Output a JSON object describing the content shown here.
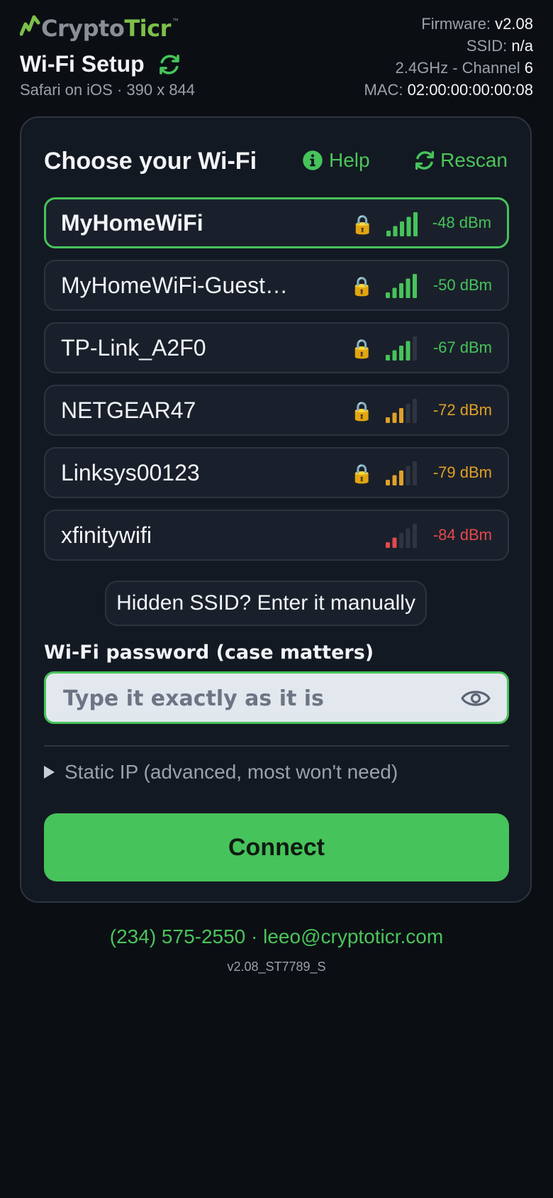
{
  "brand": {
    "logo_prefix": "Crypto",
    "logo_suffix": "Ticr",
    "trademark": "™"
  },
  "header": {
    "title": "Wi-Fi Setup",
    "subtitle": "Safari on iOS · 390 x 844",
    "firmware_label": "Firmware:",
    "firmware_value": "v2.08",
    "ssid_label": "SSID:",
    "ssid_value": "n/a",
    "band_label": "2.4GHz - Channel",
    "band_value": "6",
    "mac_label": "MAC:",
    "mac_value": "02:00:00:00:00:08"
  },
  "card": {
    "title": "Choose your Wi-Fi",
    "help_label": "Help",
    "rescan_label": "Rescan"
  },
  "networks": [
    {
      "name": "MyHomeWiFi",
      "locked": true,
      "signal_bars": 5,
      "dbm": "-48 dBm",
      "level": "good",
      "selected": true
    },
    {
      "name": "MyHomeWiFi-Guest…",
      "locked": true,
      "signal_bars": 5,
      "dbm": "-50 dBm",
      "level": "good",
      "selected": false
    },
    {
      "name": "TP-Link_A2F0",
      "locked": true,
      "signal_bars": 4,
      "dbm": "-67 dBm",
      "level": "good",
      "selected": false
    },
    {
      "name": "NETGEAR47",
      "locked": true,
      "signal_bars": 3,
      "dbm": "-72 dBm",
      "level": "fair",
      "selected": false
    },
    {
      "name": "Linksys00123",
      "locked": true,
      "signal_bars": 3,
      "dbm": "-79 dBm",
      "level": "fair",
      "selected": false
    },
    {
      "name": "xfinitywifi",
      "locked": false,
      "signal_bars": 2,
      "dbm": "-84 dBm",
      "level": "poor",
      "selected": false
    }
  ],
  "level_colors": {
    "good": "#46c35a",
    "fair": "#e0a029",
    "poor": "#e5484d",
    "off": "#2e3440"
  },
  "hidden_ssid_label": "Hidden SSID? Enter it manually",
  "password": {
    "label": "Wi-Fi password (case matters)",
    "placeholder": "Type it exactly as it is",
    "value": ""
  },
  "static_ip_label": "Static IP (advanced, most won't need)",
  "connect_label": "Connect",
  "footer": {
    "contact": "(234) 575-2550 · leeo@cryptoticr.com",
    "version": "v2.08_ST7789_S"
  }
}
